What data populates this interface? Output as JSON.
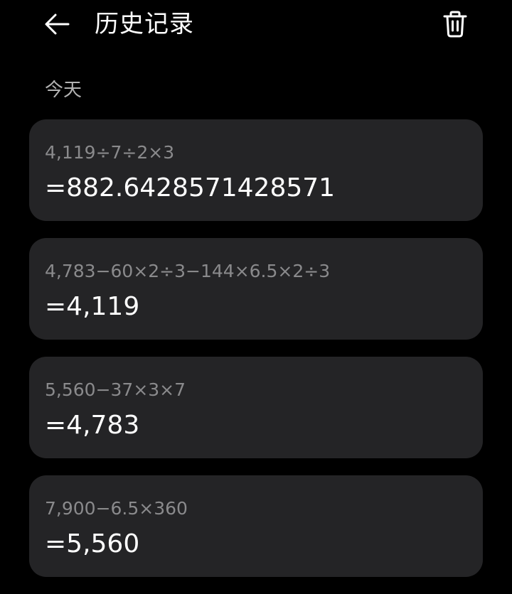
{
  "header": {
    "title": "历史记录",
    "back_icon": "arrow-left-icon",
    "delete_icon": "trash-icon"
  },
  "section": {
    "label": "今天"
  },
  "history": [
    {
      "expression": "4,119÷7÷2×3",
      "result": "=882.6428571428571"
    },
    {
      "expression": "4,783−60×2÷3−144×6.5×2÷3",
      "result": "=4,119"
    },
    {
      "expression": "5,560−37×3×7",
      "result": "=4,783"
    },
    {
      "expression": "7,900−6.5×360",
      "result": "=5,560"
    }
  ],
  "colors": {
    "background": "#000000",
    "card": "#242426",
    "expression_text": "#8a8a8c",
    "result_text": "#ffffff",
    "section_text": "#b3b3b3"
  }
}
